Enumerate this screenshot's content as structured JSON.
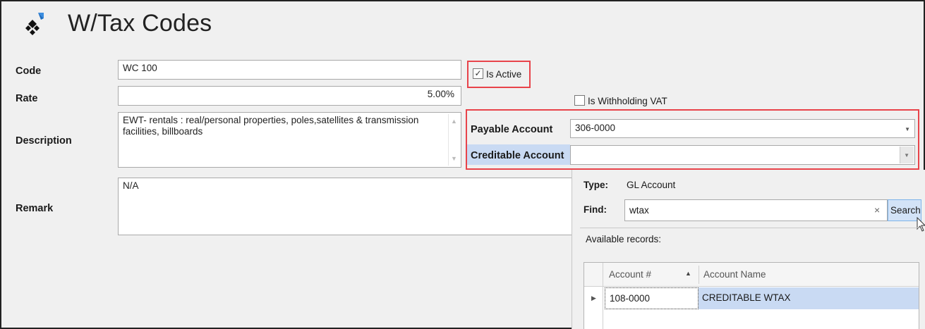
{
  "header": {
    "title": "W/Tax Codes",
    "logo_icon": "tax-codes-logo-icon"
  },
  "form": {
    "code_label": "Code",
    "code_value": "WC 100",
    "rate_label": "Rate",
    "rate_value": "5.00%",
    "description_label": "Description",
    "description_value": "EWT- rentals : real/personal properties, poles,satellites & transmission facilities, billboards",
    "remark_label": "Remark",
    "remark_value": "N/A",
    "is_active_label": "Is Active",
    "is_active_checked": true,
    "is_withholding_vat_label": "Is Withholding VAT",
    "is_withholding_vat_checked": false,
    "payable_account_label": "Payable Account",
    "payable_account_value": "306-0000",
    "creditable_account_label": "Creditable Account",
    "creditable_account_value": ""
  },
  "lookup": {
    "type_label": "Type:",
    "type_value": "GL Account",
    "find_label": "Find:",
    "find_value": "wtax",
    "clear_glyph": "×",
    "search_label": "Search",
    "available_label": "Available records:",
    "columns": [
      "Account #",
      "Account Name"
    ],
    "sort_column": "Account #",
    "sort_direction": "ascending",
    "rows": [
      {
        "account": "108-0000",
        "name": "CREDITABLE WTAX"
      }
    ]
  },
  "colors": {
    "highlight_box": "#e8434a",
    "selection": "#c9daf3",
    "search_button": "#d3e3f7"
  }
}
